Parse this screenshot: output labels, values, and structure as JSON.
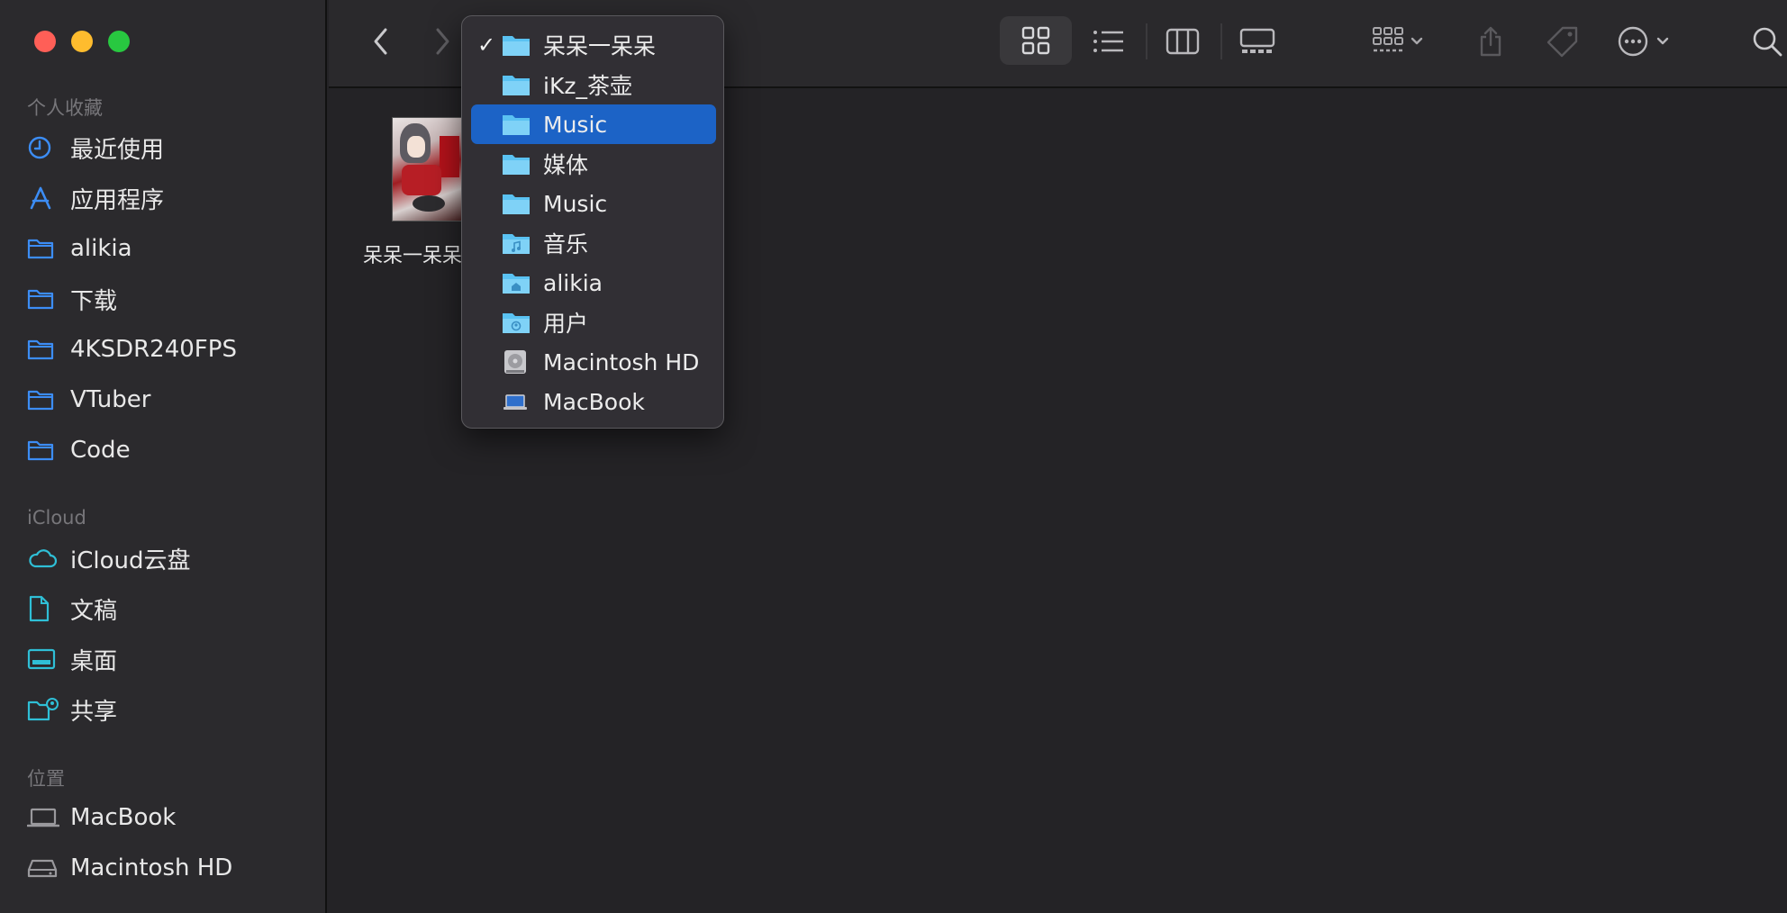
{
  "sidebar": {
    "favorites_title": "个人收藏",
    "favorites": [
      {
        "label": "最近使用",
        "icon": "clock-icon"
      },
      {
        "label": "应用程序",
        "icon": "applications-icon"
      },
      {
        "label": "alikia",
        "icon": "folder-icon"
      },
      {
        "label": "下载",
        "icon": "folder-icon"
      },
      {
        "label": "4KSDR240FPS",
        "icon": "folder-icon"
      },
      {
        "label": "VTuber",
        "icon": "folder-icon"
      },
      {
        "label": "Code",
        "icon": "folder-icon"
      }
    ],
    "icloud_title": "iCloud",
    "icloud": [
      {
        "label": "iCloud云盘",
        "icon": "cloud-icon"
      },
      {
        "label": "文稿",
        "icon": "document-icon"
      },
      {
        "label": "桌面",
        "icon": "desktop-icon"
      },
      {
        "label": "共享",
        "icon": "shared-folder-icon"
      }
    ],
    "locations_title": "位置",
    "locations": [
      {
        "label": "MacBook",
        "icon": "laptop-icon"
      },
      {
        "label": "Macintosh HD",
        "icon": "hard-drive-icon"
      }
    ]
  },
  "toolbar": {
    "back_icon": "chevron-left-icon",
    "forward_icon": "chevron-right-icon",
    "view_modes": [
      "icon-view",
      "list-view",
      "column-view",
      "gallery-view"
    ],
    "active_view": "icon-view",
    "group_icon": "group-icon",
    "share_icon": "share-icon",
    "tag_icon": "tag-icon",
    "more_icon": "ellipsis-circle-icon",
    "search_icon": "search-icon"
  },
  "content": {
    "files": [
      {
        "name": "呆呆一呆呆",
        "kind": "image"
      }
    ]
  },
  "path_menu": {
    "items": [
      {
        "label": "呆呆一呆呆",
        "icon": "folder-icon",
        "checked": true,
        "selected": false
      },
      {
        "label": "iKz_茶壶",
        "icon": "folder-icon",
        "checked": false,
        "selected": false
      },
      {
        "label": "Music",
        "icon": "folder-icon",
        "checked": false,
        "selected": true
      },
      {
        "label": "媒体",
        "icon": "folder-icon",
        "checked": false,
        "selected": false
      },
      {
        "label": "Music",
        "icon": "folder-icon",
        "checked": false,
        "selected": false
      },
      {
        "label": "音乐",
        "icon": "music-folder-icon",
        "checked": false,
        "selected": false
      },
      {
        "label": "alikia",
        "icon": "home-folder-icon",
        "checked": false,
        "selected": false
      },
      {
        "label": "用户",
        "icon": "users-folder-icon",
        "checked": false,
        "selected": false
      },
      {
        "label": "Macintosh HD",
        "icon": "hard-drive-icon",
        "checked": false,
        "selected": false
      },
      {
        "label": "MacBook",
        "icon": "laptop-icon",
        "checked": false,
        "selected": false
      }
    ],
    "check_glyph": "✓"
  },
  "colors": {
    "accent": "#1c63c6",
    "sidebar_icon": "#3c8df5",
    "folder": "#5ac2f2"
  }
}
